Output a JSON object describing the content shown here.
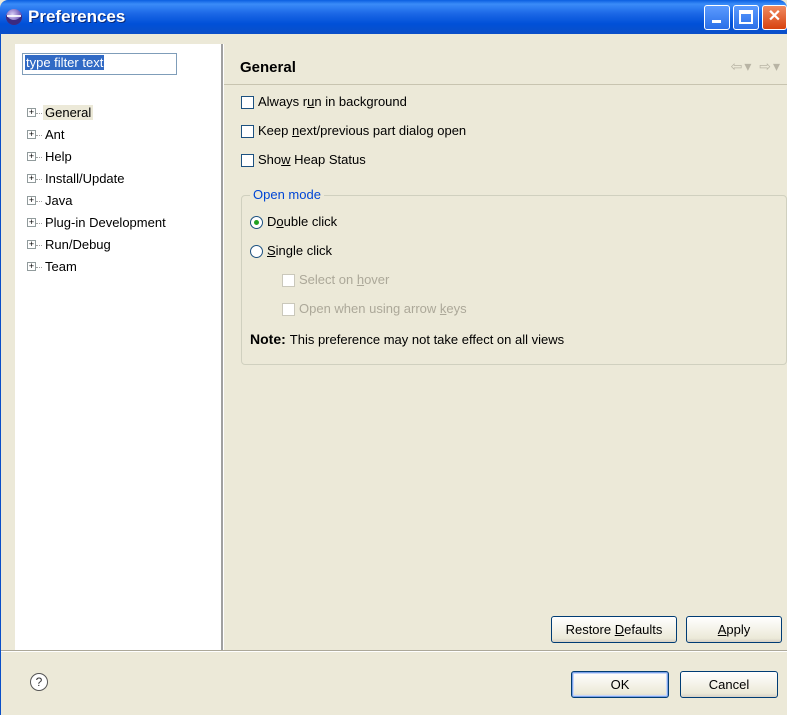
{
  "window": {
    "title": "Preferences"
  },
  "filter": {
    "value": "type filter text"
  },
  "tree": {
    "items": [
      {
        "label": "General",
        "selected": true
      },
      {
        "label": "Ant"
      },
      {
        "label": "Help"
      },
      {
        "label": "Install/Update"
      },
      {
        "label": "Java"
      },
      {
        "label": "Plug-in Development"
      },
      {
        "label": "Run/Debug"
      },
      {
        "label": "Team"
      }
    ]
  },
  "page": {
    "title": "General",
    "nav": {
      "back_icon": "back-arrow-icon",
      "forward_icon": "forward-arrow-icon"
    },
    "checkboxes": {
      "run_background": {
        "pre": "Always r",
        "mn": "u",
        "post": "n in background",
        "checked": false
      },
      "keep_open": {
        "pre": "Keep ",
        "mn": "n",
        "post": "ext/previous part dialog open",
        "checked": false
      },
      "heap_status": {
        "pre": "Sho",
        "mn": "w",
        "post": " Heap Status",
        "checked": false
      }
    },
    "open_mode": {
      "label": "Open mode",
      "double_click": {
        "pre": "D",
        "mn": "o",
        "post": "uble click",
        "selected": true
      },
      "single_click": {
        "pre": "",
        "mn": "S",
        "post": "ingle click",
        "selected": false
      },
      "select_on_hover": {
        "pre": "Select on ",
        "mn": "h",
        "post": "over",
        "enabled": false
      },
      "arrow_keys": {
        "pre": "Open when using arrow ",
        "mn": "k",
        "post": "eys",
        "enabled": false
      },
      "note_label": "Note:",
      "note_text": "This preference may not take effect on all views"
    },
    "buttons": {
      "restore": {
        "pre": "Restore ",
        "mn": "D",
        "post": "efaults"
      },
      "apply": {
        "pre": "",
        "mn": "A",
        "post": "pply"
      }
    }
  },
  "footer": {
    "help_icon": "help-icon",
    "ok": "OK",
    "cancel": "Cancel"
  }
}
